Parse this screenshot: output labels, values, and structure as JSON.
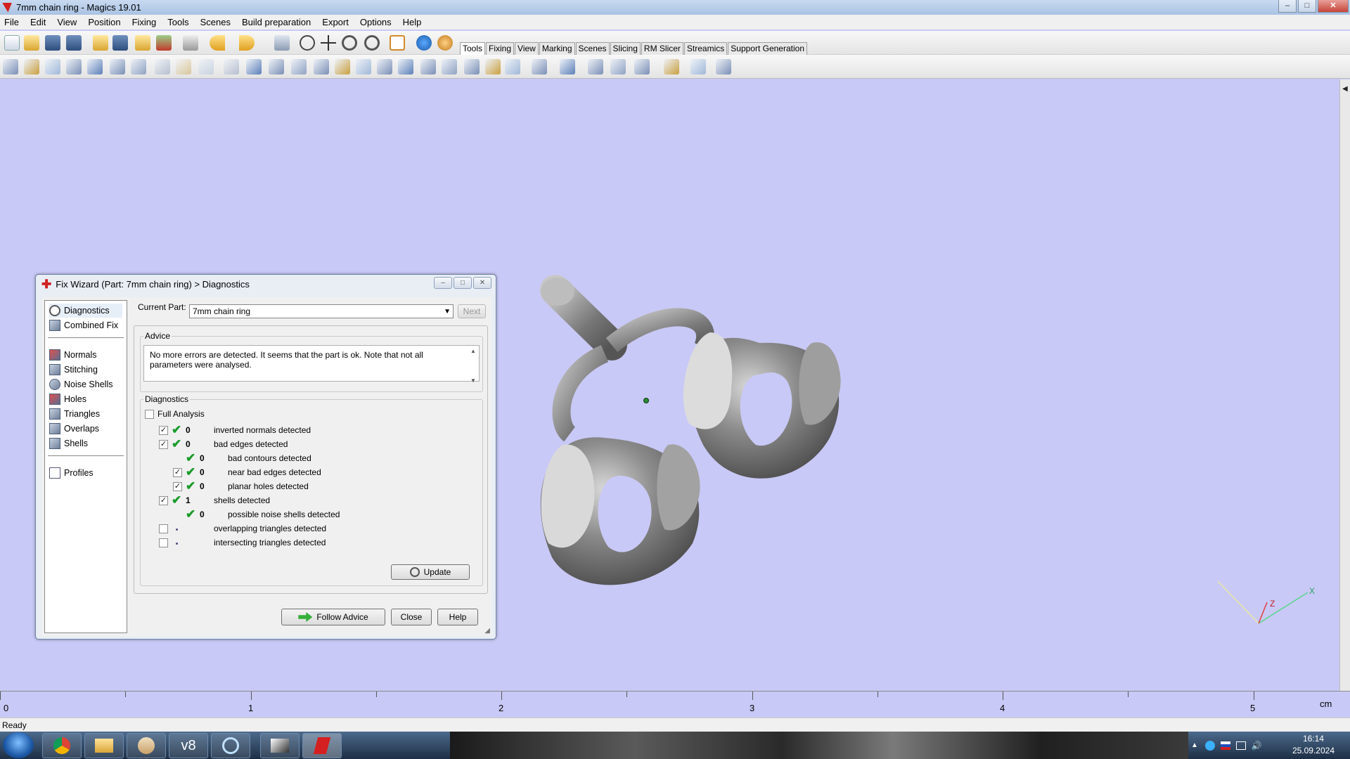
{
  "window": {
    "title": "7mm chain ring - Magics 19.01",
    "minimize": "–",
    "restore": "□",
    "close": "✕"
  },
  "menu": [
    "File",
    "Edit",
    "View",
    "Position",
    "Fixing",
    "Tools",
    "Scenes",
    "Build preparation",
    "Export",
    "Options",
    "Help"
  ],
  "toolbar_tabs": [
    "Tools",
    "Fixing",
    "View",
    "Marking",
    "Scenes",
    "Slicing",
    "RM Slicer",
    "Streamics",
    "Support Generation"
  ],
  "active_tab": "Tools",
  "ruler": {
    "labels": [
      "0",
      "1",
      "2",
      "3",
      "4",
      "5"
    ],
    "unit": "cm"
  },
  "status": "Ready",
  "clock": {
    "time": "16:14",
    "date": "25.09.2024"
  },
  "axes": {
    "z": "Z",
    "x": "X"
  },
  "dialog": {
    "title": "Fix Wizard (Part: 7mm chain ring) > Diagnostics",
    "nav_top": [
      "Diagnostics",
      "Combined Fix"
    ],
    "nav_tools": [
      "Normals",
      "Stitching",
      "Noise Shells",
      "Holes",
      "Triangles",
      "Overlaps",
      "Shells"
    ],
    "nav_bottom": [
      "Profiles"
    ],
    "current_part_label": "Current Part:",
    "current_part_value": "7mm chain ring",
    "next_button": "Next",
    "advice_legend": "Advice",
    "advice_text": "No more errors are detected. It seems that the part is ok. Note that not all parameters were analysed.",
    "diagnostics_legend": "Diagnostics",
    "full_analysis": "Full Analysis",
    "rows": [
      {
        "checked": true,
        "status": "ok",
        "value": "0",
        "label": "inverted normals detected",
        "indent": 0
      },
      {
        "checked": true,
        "status": "ok",
        "value": "0",
        "label": "bad edges detected",
        "indent": 0
      },
      {
        "checked": null,
        "status": "ok",
        "value": "0",
        "label": "bad contours detected",
        "indent": 1
      },
      {
        "checked": true,
        "status": "ok",
        "value": "0",
        "label": "near bad edges detected",
        "indent": 1
      },
      {
        "checked": true,
        "status": "ok",
        "value": "0",
        "label": "planar holes detected",
        "indent": 1
      },
      {
        "checked": true,
        "status": "ok",
        "value": "1",
        "label": "shells detected",
        "indent": 0
      },
      {
        "checked": null,
        "status": "ok",
        "value": "0",
        "label": "possible noise shells detected",
        "indent": 1
      },
      {
        "checked": false,
        "status": "none",
        "value": "",
        "label": "overlapping triangles detected",
        "indent": 0
      },
      {
        "checked": false,
        "status": "none",
        "value": "",
        "label": "intersecting triangles detected",
        "indent": 0
      }
    ],
    "update_button": "Update",
    "follow_advice_button": "Follow Advice",
    "close_button": "Close",
    "help_button": "Help"
  },
  "colors": {
    "viewport": "#c9c9f7",
    "model": "#8a8a8a",
    "ok": "#1a9b2a"
  }
}
